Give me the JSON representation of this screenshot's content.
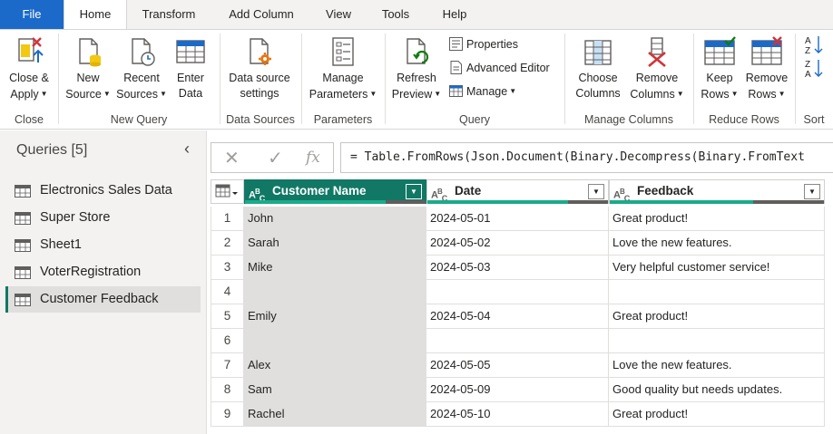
{
  "tabs": [
    {
      "label": "File"
    },
    {
      "label": "Home"
    },
    {
      "label": "Transform"
    },
    {
      "label": "Add Column"
    },
    {
      "label": "View"
    },
    {
      "label": "Tools"
    },
    {
      "label": "Help"
    }
  ],
  "ribbon": {
    "close": {
      "line1": "Close &",
      "line2": "Apply",
      "group": "Close"
    },
    "new_query": {
      "new_source": {
        "line1": "New",
        "line2": "Source"
      },
      "recent_sources": {
        "line1": "Recent",
        "line2": "Sources"
      },
      "enter_data": {
        "line1": "Enter",
        "line2": "Data"
      },
      "group": "New Query"
    },
    "data_sources": {
      "line1": "Data source",
      "line2": "settings",
      "group": "Data Sources"
    },
    "parameters": {
      "line1": "Manage",
      "line2": "Parameters",
      "group": "Parameters"
    },
    "query": {
      "refresh": {
        "line1": "Refresh",
        "line2": "Preview"
      },
      "properties": "Properties",
      "advanced_editor": "Advanced Editor",
      "manage": "Manage",
      "group": "Query"
    },
    "manage_columns": {
      "choose": {
        "line1": "Choose",
        "line2": "Columns"
      },
      "remove": {
        "line1": "Remove",
        "line2": "Columns"
      },
      "group": "Manage Columns"
    },
    "reduce_rows": {
      "keep": {
        "line1": "Keep",
        "line2": "Rows"
      },
      "remove": {
        "line1": "Remove",
        "line2": "Rows"
      },
      "group": "Reduce Rows"
    },
    "sort": {
      "group": "Sort"
    }
  },
  "queries": {
    "title": "Queries [5]",
    "items": [
      {
        "label": "Electronics Sales Data"
      },
      {
        "label": "Super Store"
      },
      {
        "label": "Sheet1"
      },
      {
        "label": "VoterRegistration"
      },
      {
        "label": "Customer Feedback"
      }
    ],
    "selected_index": 4
  },
  "formula_bar": {
    "text": "= Table.FromRows(Json.Document(Binary.Decompress(Binary.FromText"
  },
  "table": {
    "columns": [
      {
        "name": "Customer Name",
        "type_icon": "text-type-icon"
      },
      {
        "name": "Date",
        "type_icon": "text-type-icon"
      },
      {
        "name": "Feedback",
        "type_icon": "text-type-icon"
      }
    ],
    "rows": [
      {
        "n": "1",
        "cells": [
          "John",
          "2024-05-01",
          "Great product!"
        ]
      },
      {
        "n": "2",
        "cells": [
          "Sarah",
          "2024-05-02",
          "Love the new features."
        ]
      },
      {
        "n": "3",
        "cells": [
          "Mike",
          "2024-05-03",
          "Very helpful customer service!"
        ]
      },
      {
        "n": "4",
        "cells": [
          "",
          "",
          ""
        ]
      },
      {
        "n": "5",
        "cells": [
          "Emily",
          "2024-05-04",
          "Great product!"
        ]
      },
      {
        "n": "6",
        "cells": [
          "",
          "",
          ""
        ]
      },
      {
        "n": "7",
        "cells": [
          "Alex",
          "2024-05-05",
          "Love the new features."
        ]
      },
      {
        "n": "8",
        "cells": [
          "Sam",
          "2024-05-09",
          "Good quality but needs updates."
        ]
      },
      {
        "n": "9",
        "cells": [
          "Rachel",
          "2024-05-10",
          "Great product!"
        ]
      }
    ]
  },
  "colors": {
    "accent": "#117865",
    "file_tab": "#1b6ac9",
    "quality_valid": "#1aab8a",
    "quality_empty": "#605e5c"
  }
}
